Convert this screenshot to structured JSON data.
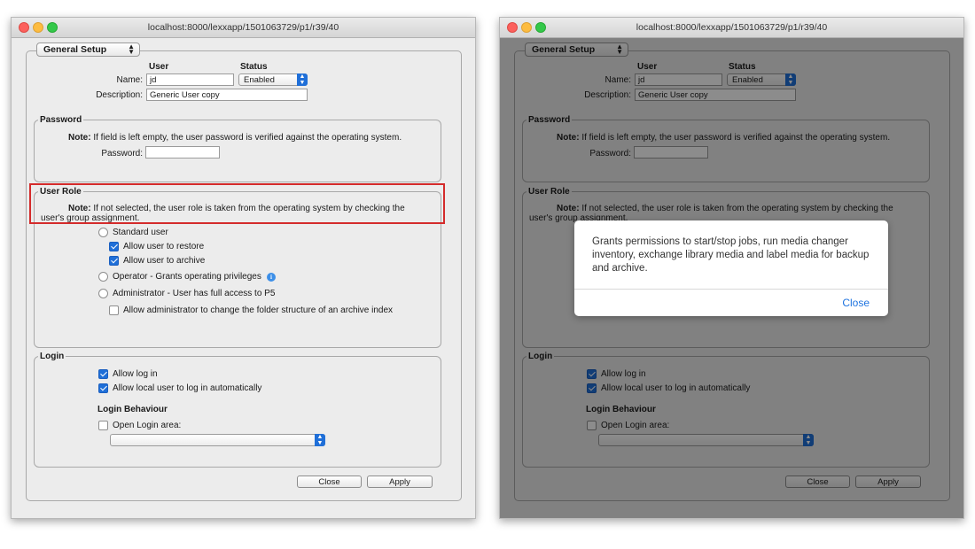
{
  "window": {
    "url": "localhost:8000/lexxapp/1501063729/p1/r39/40"
  },
  "form": {
    "section_popup": "General Setup",
    "user_header": "User",
    "status_header": "Status",
    "name_label": "Name:",
    "name_value": "jd",
    "status_value": "Enabled",
    "description_label": "Description:",
    "description_value": "Generic User copy",
    "password": {
      "legend": "Password",
      "note_bold": "Note:",
      "note_text": " If field is left empty, the user password is verified against the operating system.",
      "password_label": "Password:",
      "password_value": ""
    },
    "user_role": {
      "legend": "User Role",
      "note_bold": "Note:",
      "note_line1": " If not selected, the user role is taken from the operating system by checking the",
      "note_line2": "user's group assignment.",
      "standard_user": "Standard user",
      "allow_restore": "Allow user to restore",
      "allow_archive": "Allow user to archive",
      "operator": "Operator - Grants operating privileges",
      "administrator": "Administrator - User has full access to P5",
      "allow_admin_folder": "Allow administrator to change the folder structure of an archive index",
      "allow_restore_checked": true,
      "allow_archive_checked": true,
      "allow_admin_folder_checked": false
    },
    "login": {
      "legend": "Login",
      "allow_login": "Allow log in",
      "allow_local_auto": "Allow local user to log in automatically",
      "behaviour_heading": "Login Behaviour",
      "open_login_area": "Open Login area:",
      "login_area_value": "",
      "allow_login_checked": true,
      "allow_local_auto_checked": true,
      "open_login_area_checked": false
    },
    "close_button": "Close",
    "apply_button": "Apply"
  },
  "dialog": {
    "message": "Grants permissions to start/stop jobs, run media changer inventory, exchange library media and label media for backup and archive.",
    "close_label": "Close"
  },
  "colors": {
    "accent": "#1f6fd8",
    "highlight_box": "#d42b2b",
    "dialog_link": "#1f74e0"
  }
}
